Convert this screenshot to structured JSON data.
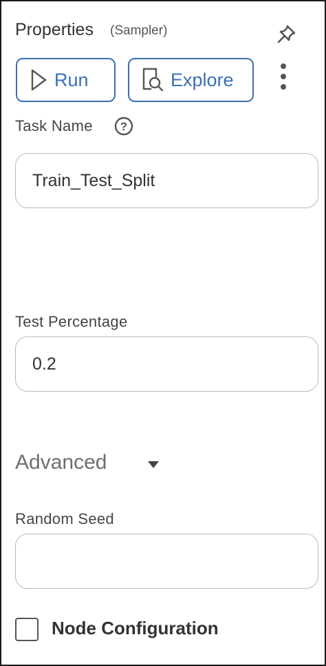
{
  "header": {
    "title": "Properties",
    "subtitle": "(Sampler)",
    "pin_icon": "pin-icon"
  },
  "toolbar": {
    "run_label": "Run",
    "run_icon": "play-icon",
    "explore_label": "Explore",
    "explore_icon": "document-search-icon",
    "more_icon": "vertical-ellipsis-icon"
  },
  "fields": {
    "task_name": {
      "label": "Task Name",
      "value": "Train_Test_Split",
      "help_icon": "question-circle-icon"
    },
    "test_percentage": {
      "label": "Test Percentage",
      "value": "0.2"
    },
    "random_seed": {
      "label": "Random Seed",
      "value": ""
    }
  },
  "advanced": {
    "label": "Advanced",
    "icon": "caret-down-icon"
  },
  "node_configuration": {
    "label": "Node Configuration",
    "checked": false
  },
  "colors": {
    "accent": "#3b6fb6",
    "border": "#1a1a1a",
    "field_border": "#b9b9b9"
  }
}
